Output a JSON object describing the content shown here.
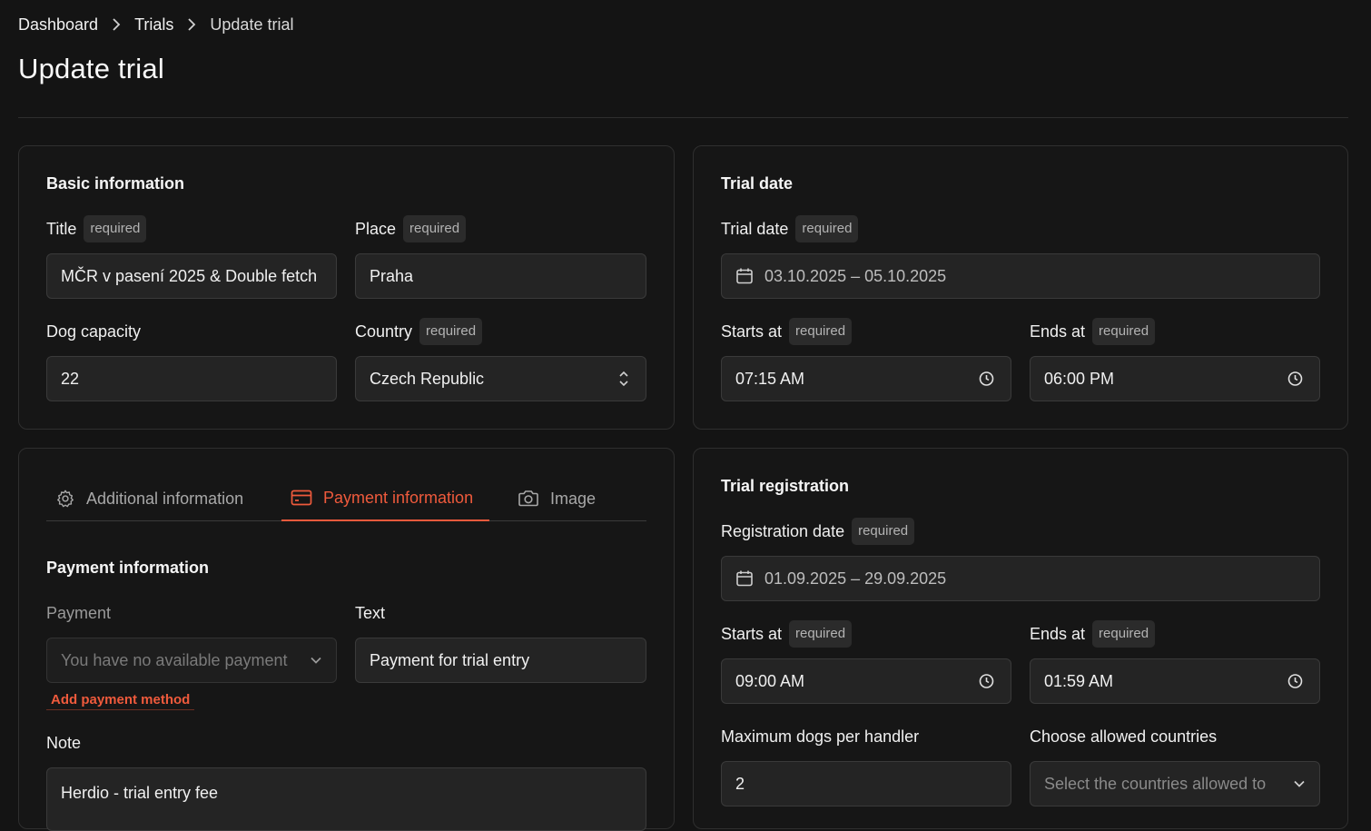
{
  "breadcrumb": {
    "items": [
      "Dashboard",
      "Trials",
      "Update trial"
    ]
  },
  "page_title": "Update trial",
  "required_badge": "required",
  "basic": {
    "title": "Basic information",
    "title_label": "Title",
    "title_value": "MČR v pasení 2025 & Double fetch",
    "place_label": "Place",
    "place_value": "Praha",
    "capacity_label": "Dog capacity",
    "capacity_value": "22",
    "country_label": "Country",
    "country_value": "Czech Republic"
  },
  "trial_date": {
    "title": "Trial date",
    "date_label": "Trial date",
    "date_value": "03.10.2025 – 05.10.2025",
    "starts_label": "Starts at",
    "starts_value": "07:15 AM",
    "ends_label": "Ends at",
    "ends_value": "06:00 PM"
  },
  "tabs": {
    "additional": "Additional information",
    "payment": "Payment information",
    "image": "Image"
  },
  "payment": {
    "title": "Payment information",
    "payment_label": "Payment",
    "payment_placeholder": "You have no available payment",
    "add_link": "Add payment method",
    "text_label": "Text",
    "text_value": "Payment for trial entry",
    "note_label": "Note",
    "note_value": "Herdio - trial entry fee"
  },
  "registration": {
    "title": "Trial registration",
    "date_label": "Registration date",
    "date_value": "01.09.2025 – 29.09.2025",
    "starts_label": "Starts at",
    "starts_value": "09:00 AM",
    "ends_label": "Ends at",
    "ends_value": "01:59 AM",
    "max_dogs_label": "Maximum dogs per handler",
    "max_dogs_value": "2",
    "countries_label": "Choose allowed countries",
    "countries_placeholder": "Select the countries allowed to"
  },
  "colors": {
    "background": "#141414",
    "accent": "#ef5a3c",
    "field_bg": "#242424",
    "border": "#2f2f2f"
  },
  "icons": [
    "chevron-right-icon",
    "calendar-icon",
    "clock-icon",
    "updown-chevron-icon",
    "chevron-down-icon",
    "gear-icon",
    "credit-card-icon",
    "camera-icon"
  ]
}
